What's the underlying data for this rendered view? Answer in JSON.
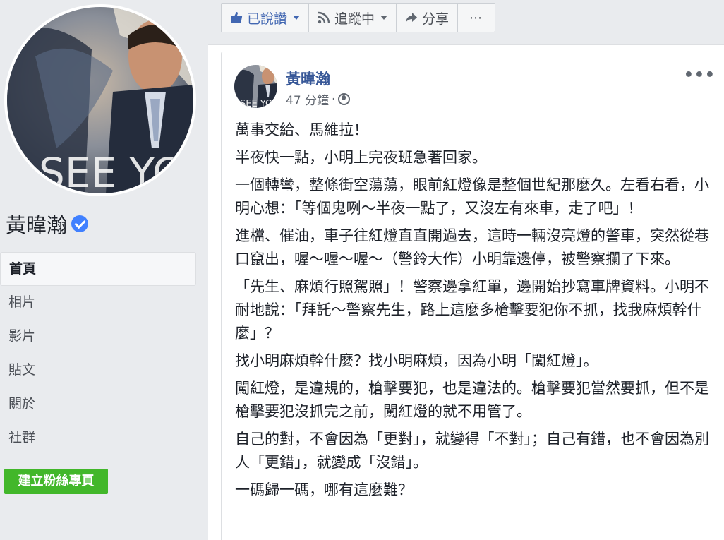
{
  "page": {
    "name": "黃暐瀚",
    "verified": true
  },
  "sidebar": {
    "items": [
      {
        "label": "首頁",
        "active": true
      },
      {
        "label": "相片",
        "active": false
      },
      {
        "label": "影片",
        "active": false
      },
      {
        "label": "貼文",
        "active": false
      },
      {
        "label": "關於",
        "active": false
      },
      {
        "label": "社群",
        "active": false
      }
    ],
    "create_page_label": "建立粉絲專頁"
  },
  "action_bar": {
    "liked_label": "已說讚",
    "follow_label": "追蹤中",
    "share_label": "分享",
    "more_label": "⋯"
  },
  "post": {
    "author": "黃暐瀚",
    "time": "47 分鐘",
    "separator": "·",
    "menu_label": "•••",
    "paragraphs": [
      "萬事交給、馬維拉！",
      "半夜快一點，小明上完夜班急著回家。",
      "一個轉彎，整條街空蕩蕩，眼前紅燈像是整個世紀那麼久。左看右看，小明心想：「等個鬼咧～半夜一點了，又沒左有來車，走了吧」！",
      "進檔、催油，車子往紅燈直直開過去，這時一輛沒亮燈的警車，突然從巷口竄出，喔～喔～喔～（警鈴大作）小明靠邊停，被警察攔了下來。",
      "「先生、麻煩行照駕照」！警察邊拿紅單，邊開始抄寫車牌資料。小明不耐地說：「拜託～警察先生，路上這麼多槍擊要犯你不抓，找我麻煩幹什麼」？",
      "找小明麻煩幹什麼？找小明麻煩，因為小明「闖紅燈」。",
      "闖紅燈，是違規的，槍擊要犯，也是違法的。槍擊要犯當然要抓，但不是槍擊要犯沒抓完之前，闖紅燈的就不用管了。",
      "自己的對，不會因為「更對」，就變得「不對」；自己有錯，也不會因為別人「更錯」，就變成「沒錯」。",
      "一碼歸一碼，哪有這麼難？"
    ]
  },
  "colors": {
    "link": "#385898",
    "accent": "#4267b2",
    "green": "#42b72a",
    "verified": "#4080ff"
  }
}
